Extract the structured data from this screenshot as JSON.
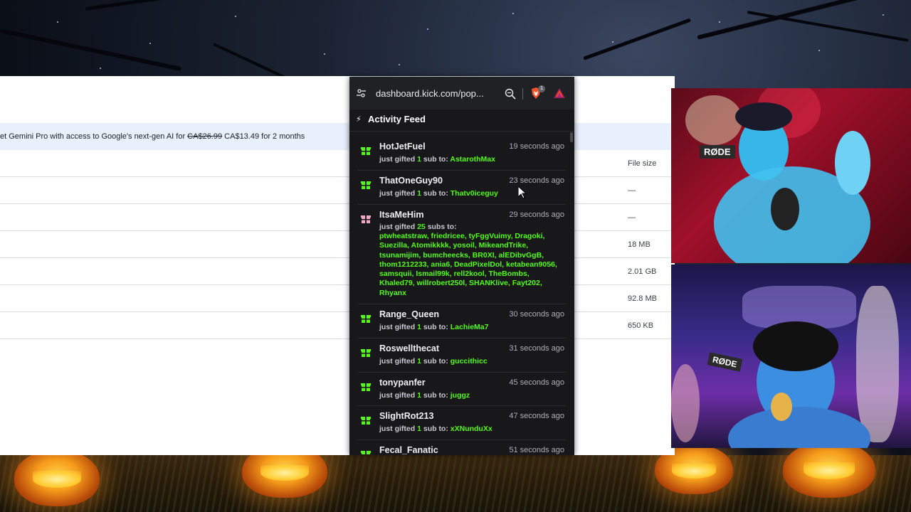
{
  "browser_page": {
    "promo_text_prefix": "et Gemini Pro with access to Google's next-gen AI for ",
    "promo_old_price": "CA$26.99",
    "promo_new_price": " CA$13.49 for 2 months",
    "file_size_header": "File size",
    "file_sizes": [
      "—",
      "—",
      "18 MB",
      "2.01 GB",
      "92.8 MB",
      "650 KB"
    ]
  },
  "popup": {
    "url": "dashboard.kick.com/pop...",
    "extension_badge": "1",
    "feed_title": "Activity Feed",
    "items": [
      {
        "username": "HotJetFuel",
        "time": "19 seconds ago",
        "prefix": "just gifted ",
        "count": "1",
        "unit": " sub to: ",
        "recipient": "AstarothMax"
      },
      {
        "username": "ThatOneGuy90",
        "time": "23 seconds ago",
        "prefix": "just gifted ",
        "count": "1",
        "unit": " sub to: ",
        "recipient": "Thatv0iceguy"
      },
      {
        "username": "ItsaMeHim",
        "time": "29 seconds ago",
        "prefix": "just gifted ",
        "count": "25",
        "unit": " subs to:",
        "recipient": "ptwheatstraw, friedricee, tyFggVuimy, Dragoki, Suezilla, Atomikkkk, yosoil, MikeandTrike, tsunamijim, bumcheecks, BR0XI, alEDibvGgB, thom1212233, ania6, DeadPixelDol, ketabean9056, samsquii, Ismail99k, rell2kool, TheBombs, Khaled79, willrobert250l, SHANKlive, Fayt202, Rhyanx"
      },
      {
        "username": "Range_Queen",
        "time": "30 seconds ago",
        "prefix": "just gifted ",
        "count": "1",
        "unit": " sub to: ",
        "recipient": "LachieMa7"
      },
      {
        "username": "Roswellthecat",
        "time": "31 seconds ago",
        "prefix": "just gifted ",
        "count": "1",
        "unit": " sub to: ",
        "recipient": "guccithicc"
      },
      {
        "username": "tonypanfer",
        "time": "45 seconds ago",
        "prefix": "just gifted ",
        "count": "1",
        "unit": " sub to: ",
        "recipient": "juggz"
      },
      {
        "username": "SlightRot213",
        "time": "47 seconds ago",
        "prefix": "just gifted ",
        "count": "1",
        "unit": " sub to: ",
        "recipient": "xXNunduXx"
      },
      {
        "username": "Fecal_Fanatic",
        "time": "51 seconds ago"
      }
    ]
  },
  "webcams": {
    "mic_brand_top": "RØDE",
    "mic_brand_bottom": "RØDE"
  },
  "colors": {
    "kick_green": "#53fc18",
    "popup_bg": "#18181b",
    "promo_bg": "#e8f0fe"
  }
}
